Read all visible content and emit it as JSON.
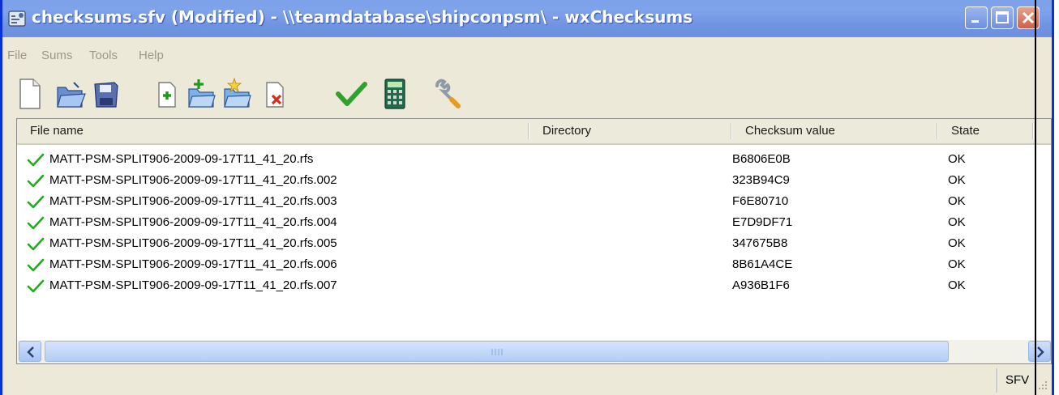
{
  "window": {
    "title": "checksums.sfv (Modified) - \\\\teamdatabase\\shipconpsm\\ - wxChecksums",
    "app_icon": "wxchecksums-app-icon",
    "controls": [
      "minimize-icon",
      "maximize-icon",
      "close-icon"
    ]
  },
  "menu": {
    "items": [
      "File",
      "Sums",
      "Tools",
      "Help"
    ]
  },
  "toolbar": {
    "buttons": [
      {
        "icon": "new-file-icon"
      },
      {
        "icon": "open-folder-icon"
      },
      {
        "icon": "save-disk-icon"
      },
      {
        "icon": "add-file-icon"
      },
      {
        "icon": "add-directory-icon"
      },
      {
        "icon": "add-matching-files-icon"
      },
      {
        "icon": "remove-file-icon"
      },
      {
        "icon": "check-sums-icon"
      },
      {
        "icon": "calculator-icon"
      },
      {
        "icon": "configure-wrench-icon"
      }
    ]
  },
  "list": {
    "columns": [
      "File name",
      "Directory",
      "Checksum value",
      "State"
    ],
    "rows": [
      {
        "file": "MATT-PSM-SPLIT906-2009-09-17T11_41_20.rfs",
        "directory": "",
        "checksum": "B6806E0B",
        "state": "OK"
      },
      {
        "file": "MATT-PSM-SPLIT906-2009-09-17T11_41_20.rfs.002",
        "directory": "",
        "checksum": "323B94C9",
        "state": "OK"
      },
      {
        "file": "MATT-PSM-SPLIT906-2009-09-17T11_41_20.rfs.003",
        "directory": "",
        "checksum": "F6E80710",
        "state": "OK"
      },
      {
        "file": "MATT-PSM-SPLIT906-2009-09-17T11_41_20.rfs.004",
        "directory": "",
        "checksum": "E7D9DF71",
        "state": "OK"
      },
      {
        "file": "MATT-PSM-SPLIT906-2009-09-17T11_41_20.rfs.005",
        "directory": "",
        "checksum": "347675B8",
        "state": "OK"
      },
      {
        "file": "MATT-PSM-SPLIT906-2009-09-17T11_41_20.rfs.006",
        "directory": "",
        "checksum": "8B61A4CE",
        "state": "OK"
      },
      {
        "file": "MATT-PSM-SPLIT906-2009-09-17T11_41_20.rfs.007",
        "directory": "",
        "checksum": "A936B1F6",
        "state": "OK"
      }
    ]
  },
  "statusbar": {
    "format": "SFV"
  },
  "colors": {
    "title_bar": "#7fa3ea",
    "window_border": "#0831d9",
    "ok_check": "#22aa22",
    "close_button": "#d06048"
  }
}
